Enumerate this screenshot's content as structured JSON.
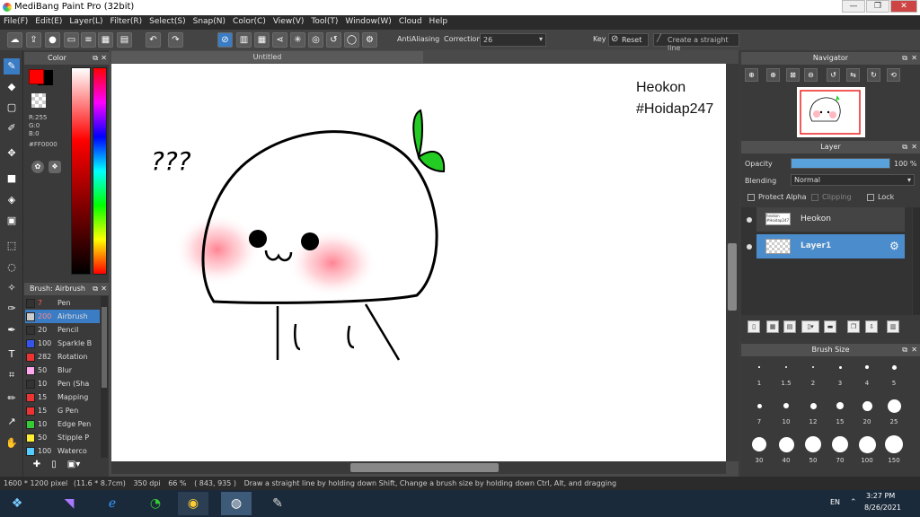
{
  "window": {
    "title": "MediBang Paint Pro (32bit)",
    "minimize": "—",
    "maximize": "❐",
    "close": "✕"
  },
  "menu": [
    "File(F)",
    "Edit(E)",
    "Layer(L)",
    "Filter(R)",
    "Select(S)",
    "Snap(N)",
    "Color(C)",
    "View(V)",
    "Tool(T)",
    "Window(W)",
    "Cloud",
    "Help"
  ],
  "toolbar": {
    "antialiasing_label": "AntiAliasing",
    "correction_label": "Correction",
    "correction_value": "26",
    "key_label": "Key",
    "reset_label": "Reset",
    "straight_line_label": "Create a straight line"
  },
  "color_panel": {
    "title": "Color",
    "r": "R:255",
    "g": "G:0",
    "b": "B:0",
    "hex": "#FF0000",
    "fg_color": "#FF0000"
  },
  "brush_panel": {
    "title": "Brush: Airbrush",
    "items": [
      {
        "size": "7",
        "name": "Pen",
        "color": "#333333"
      },
      {
        "size": "200",
        "name": "Airbrush",
        "color": "#cccccc"
      },
      {
        "size": "20",
        "name": "Pencil",
        "color": "#333333"
      },
      {
        "size": "100",
        "name": "Sparkle B",
        "color": "#3355ee"
      },
      {
        "size": "282",
        "name": "Rotation",
        "color": "#ee3333"
      },
      {
        "size": "50",
        "name": "Blur",
        "color": "#ffaaee"
      },
      {
        "size": "10",
        "name": "Pen (Sha",
        "color": "#333333"
      },
      {
        "size": "15",
        "name": "Mapping",
        "color": "#ee3333"
      },
      {
        "size": "15",
        "name": "G Pen",
        "color": "#ee3333"
      },
      {
        "size": "10",
        "name": "Edge Pen",
        "color": "#33cc33"
      },
      {
        "size": "50",
        "name": "Stipple P",
        "color": "#ffee33"
      },
      {
        "size": "100",
        "name": "Waterco",
        "color": "#55ccff"
      }
    ]
  },
  "document": {
    "tab_title": "Untitled"
  },
  "canvas_text": {
    "line1": "Heokon",
    "line2": "#Hoidap247",
    "question": "???"
  },
  "navigator": {
    "title": "Navigator"
  },
  "layer_panel": {
    "title": "Layer",
    "opacity_label": "Opacity",
    "opacity_value": "100 %",
    "opacity_fraction": 1.0,
    "blending_label": "Blending",
    "blending_value": "Normal",
    "protect_alpha": "Protect Alpha",
    "clipping": "Clipping",
    "lock": "Lock",
    "layers": [
      {
        "name": "Heokon",
        "thumb": "heokon #Hoidap247"
      },
      {
        "name": "Layer1",
        "thumb": ""
      }
    ]
  },
  "brush_size_panel": {
    "title": "Brush Size",
    "sizes": [
      "1",
      "1.5",
      "2",
      "3",
      "4",
      "5",
      "7",
      "10",
      "12",
      "15",
      "20",
      "25",
      "30",
      "40",
      "50",
      "70",
      "100",
      "150"
    ]
  },
  "status": {
    "dims": "1600 * 1200 pixel",
    "cm": "(11.6 * 8.7cm)",
    "dpi": "350 dpi",
    "zoom": "66 %",
    "coords": "( 843, 935 )",
    "hint": "Draw a straight line by holding down Shift, Change a brush size by holding down Ctrl, Alt, and dragging"
  },
  "taskbar": {
    "lang": "EN",
    "time": "3:27 PM",
    "date": "8/26/2021"
  }
}
